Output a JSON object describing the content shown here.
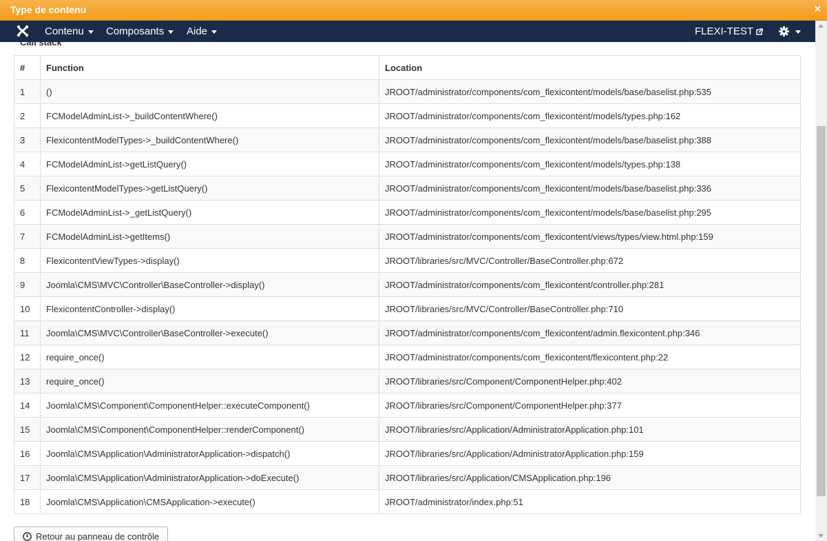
{
  "modal": {
    "title": "Type de contenu",
    "close_label": "×"
  },
  "navbar": {
    "menu": [
      {
        "label": "Contenu"
      },
      {
        "label": "Composants"
      },
      {
        "label": "Aide"
      }
    ],
    "site_link": "FLEXI-TEST",
    "brand_color": "#1a2b4a",
    "title_bar_color": "#f39c1a"
  },
  "call_stack": {
    "heading": "Call stack",
    "headers": {
      "num": "#",
      "function": "Function",
      "location": "Location"
    },
    "rows": [
      {
        "num": "1",
        "function": "()",
        "location": "JROOT/administrator/components/com_flexicontent/models/base/baselist.php:535"
      },
      {
        "num": "2",
        "function": "FCModelAdminList->_buildContentWhere()",
        "location": "JROOT/administrator/components/com_flexicontent/models/types.php:162"
      },
      {
        "num": "3",
        "function": "FlexicontentModelTypes->_buildContentWhere()",
        "location": "JROOT/administrator/components/com_flexicontent/models/base/baselist.php:388"
      },
      {
        "num": "4",
        "function": "FCModelAdminList->getListQuery()",
        "location": "JROOT/administrator/components/com_flexicontent/models/types.php:138"
      },
      {
        "num": "5",
        "function": "FlexicontentModelTypes->getListQuery()",
        "location": "JROOT/administrator/components/com_flexicontent/models/base/baselist.php:336"
      },
      {
        "num": "6",
        "function": "FCModelAdminList->_getListQuery()",
        "location": "JROOT/administrator/components/com_flexicontent/models/base/baselist.php:295"
      },
      {
        "num": "7",
        "function": "FCModelAdminList->getItems()",
        "location": "JROOT/administrator/components/com_flexicontent/views/types/view.html.php:159"
      },
      {
        "num": "8",
        "function": "FlexicontentViewTypes->display()",
        "location": "JROOT/libraries/src/MVC/Controller/BaseController.php:672"
      },
      {
        "num": "9",
        "function": "Joomla\\CMS\\MVC\\Controller\\BaseController->display()",
        "location": "JROOT/administrator/components/com_flexicontent/controller.php:281"
      },
      {
        "num": "10",
        "function": "FlexicontentController->display()",
        "location": "JROOT/libraries/src/MVC/Controller/BaseController.php:710"
      },
      {
        "num": "11",
        "function": "Joomla\\CMS\\MVC\\Controller\\BaseController->execute()",
        "location": "JROOT/administrator/components/com_flexicontent/admin.flexicontent.php:346"
      },
      {
        "num": "12",
        "function": "require_once()",
        "location": "JROOT/administrator/components/com_flexicontent/flexicontent.php:22"
      },
      {
        "num": "13",
        "function": "require_once()",
        "location": "JROOT/libraries/src/Component/ComponentHelper.php:402"
      },
      {
        "num": "14",
        "function": "Joomla\\CMS\\Component\\ComponentHelper::executeComponent()",
        "location": "JROOT/libraries/src/Component/ComponentHelper.php:377"
      },
      {
        "num": "15",
        "function": "Joomla\\CMS\\Component\\ComponentHelper::renderComponent()",
        "location": "JROOT/libraries/src/Application/AdministratorApplication.php:101"
      },
      {
        "num": "16",
        "function": "Joomla\\CMS\\Application\\AdministratorApplication->dispatch()",
        "location": "JROOT/libraries/src/Application/AdministratorApplication.php:159"
      },
      {
        "num": "17",
        "function": "Joomla\\CMS\\Application\\AdministratorApplication->doExecute()",
        "location": "JROOT/libraries/src/Application/CMSApplication.php:196"
      },
      {
        "num": "18",
        "function": "Joomla\\CMS\\Application\\CMSApplication->execute()",
        "location": "JROOT/administrator/index.php:51"
      }
    ]
  },
  "back_button": {
    "label": "Retour au panneau de contrôle"
  }
}
